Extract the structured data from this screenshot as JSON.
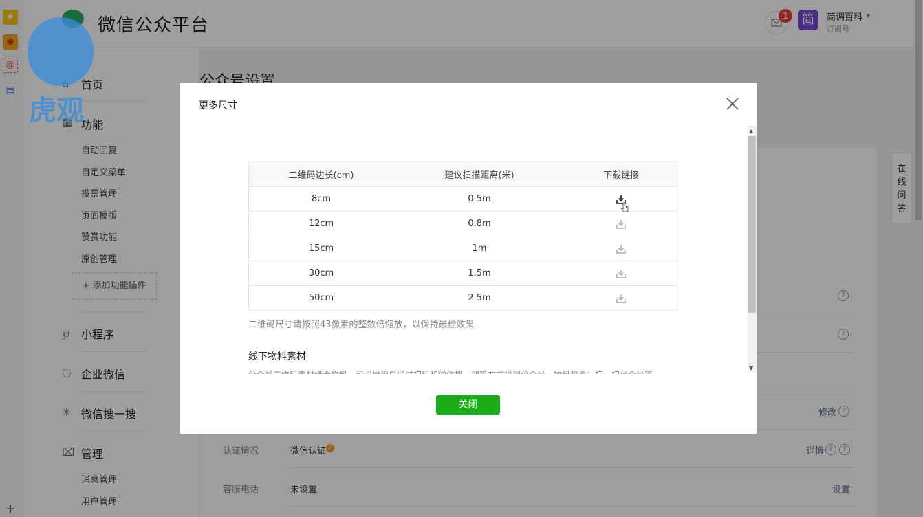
{
  "header": {
    "platform_title": "微信公众平台",
    "watermark_text": "虎观",
    "mail_badge": "1",
    "avatar_char": "简",
    "account_name": "简调百科",
    "account_type": "订阅号",
    "dropdown_arrow": "▾"
  },
  "sidebar": {
    "home": "首页",
    "features": "功能",
    "feature_items": [
      "自动回复",
      "自定义菜单",
      "投票管理",
      "页面模版",
      "赞赏功能",
      "原创管理"
    ],
    "add_plugin": "+ 添加功能插件",
    "mini_program": "小程序",
    "work_wechat": "企业微信",
    "wechat_search": "微信搜一搜",
    "manage": "管理",
    "manage_items": [
      "消息管理",
      "用户管理"
    ]
  },
  "main": {
    "page_title": "公众号设置",
    "rows": [
      {
        "label": "认证情况",
        "value": "微信认证",
        "action": "详情"
      },
      {
        "label": "客服电话",
        "value": "未设置",
        "action": "设置"
      }
    ],
    "modify_link": "修改",
    "online_help": [
      "在",
      "线",
      "问",
      "答"
    ]
  },
  "dialog": {
    "title": "更多尺寸",
    "table_headers": [
      "二维码边长(cm)",
      "建议扫描距离(米)",
      "下载链接"
    ],
    "table_rows": [
      [
        "8cm",
        "0.5m"
      ],
      [
        "12cm",
        "0.8m"
      ],
      [
        "15cm",
        "1m"
      ],
      [
        "30cm",
        "1.5m"
      ],
      [
        "50cm",
        "2.5m"
      ]
    ],
    "tip": "二维码尺寸请按照43像素的整数倍缩放，以保持最佳效果",
    "offline_heading": "线下物料素材",
    "offline_text": "公众号二维码素材结合物料，可引导用户通过扫码和微信搜一搜等方式找到公众号，物料包含：扫一扫公众号等",
    "close_button": "关闭"
  },
  "colors": {
    "brand_green": "#1aad19",
    "badge_red": "#e64340",
    "link_blue": "#576b95"
  }
}
